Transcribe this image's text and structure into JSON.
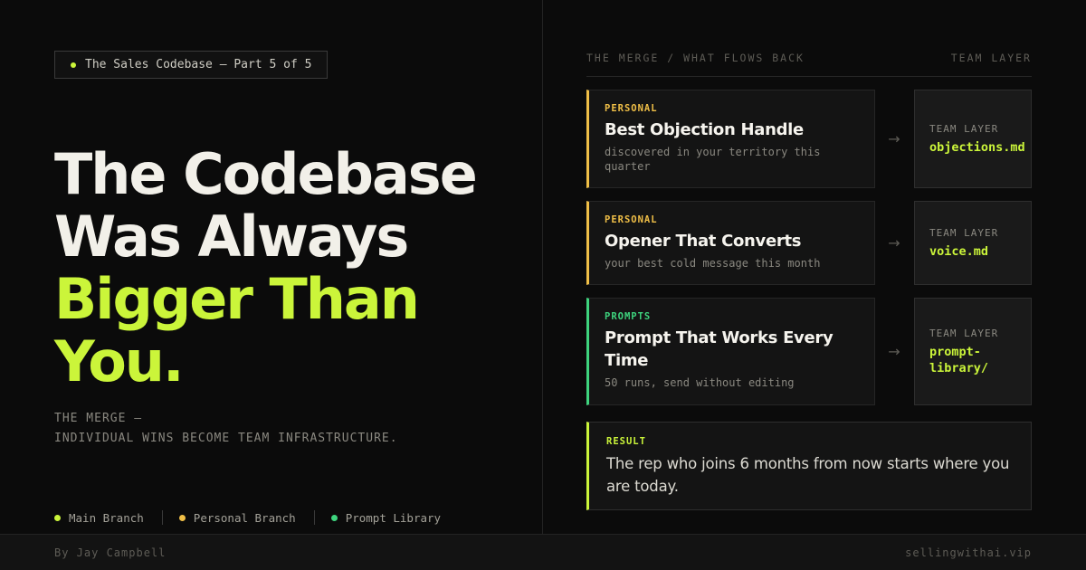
{
  "series_tag": "The Sales Codebase — Part 5 of 5",
  "headline": {
    "line1": "The Codebase",
    "line2": "Was Always",
    "line3": "Bigger Than",
    "line4": "You."
  },
  "subline": {
    "line1": "THE MERGE —",
    "line2": "INDIVIDUAL WINS BECOME TEAM INFRASTRUCTURE."
  },
  "legend": [
    {
      "label": "Main Branch",
      "color": "#cbf53a"
    },
    {
      "label": "Personal Branch",
      "color": "#f0bf47"
    },
    {
      "label": "Prompt Library",
      "color": "#3ed47e"
    }
  ],
  "panel": {
    "header_left": "THE MERGE / WHAT FLOWS BACK",
    "header_right": "TEAM LAYER"
  },
  "flows": [
    {
      "kicker": "PERSONAL",
      "title": "Best Objection Handle",
      "desc": "discovered in your territory this quarter",
      "arrow": "→",
      "target_kicker": "TEAM LAYER",
      "target_file": "objections.md"
    },
    {
      "kicker": "PERSONAL",
      "title": "Opener That Converts",
      "desc": "your best cold message this month",
      "arrow": "→",
      "target_kicker": "TEAM LAYER",
      "target_file": "voice.md"
    },
    {
      "kicker": "PROMPTS",
      "title": "Prompt That Works Every Time",
      "desc": "50 runs, send without editing",
      "arrow": "→",
      "target_kicker": "TEAM LAYER",
      "target_file": "prompt-library/"
    }
  ],
  "result": {
    "kicker": "RESULT",
    "text": "The rep who joins 6 months from now starts where you are today."
  },
  "footer": {
    "author": "By Jay Campbell",
    "site": "sellingwithai.vip"
  },
  "colors": {
    "accent": "#cbf53a",
    "personal": "#f0bf47",
    "prompts": "#3ed47e",
    "background": "#0b0b0b"
  }
}
